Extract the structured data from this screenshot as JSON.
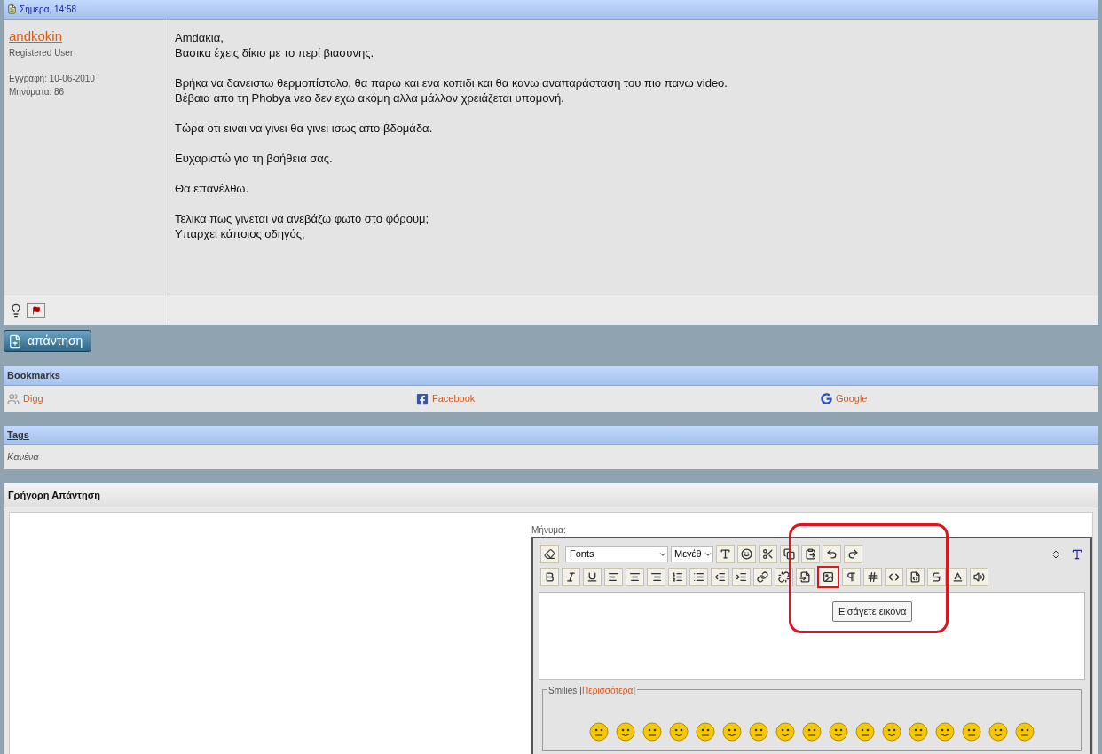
{
  "post": {
    "date": "Σήμερα, 14:58",
    "user": {
      "name": "andkokin",
      "title": "Registered User",
      "joined": "Εγγραφή: 10-06-2010",
      "posts": "Μηνύματα: 86"
    },
    "paragraphs": [
      [
        "Amdακια,",
        "Βασικα έχεις δίκιο με το περί βιασυνης."
      ],
      [
        "Βρήκα να δανειστω θερμοπίστολο, θα παρω και ενα κοπιδι και θα κανω αναπαράσταση του πιο πανω video.",
        "Βέβαια απο τη Phobya νεο δεν εχω ακόμη αλλα μάλλον χρειάζεται υπομονή."
      ],
      [
        "Τώρα οτι ειναι να γινει θα γινει ισως απο βδομάδα."
      ],
      [
        "Ευχαριστώ για τη βοήθεια σας."
      ],
      [
        "Θα επανέλθω."
      ],
      [
        "Τελικα πως γινεται να ανεβάζω φωτο στο φόρουμ;",
        "Υπαρχει κάποιος οδηγός;"
      ]
    ]
  },
  "reply_button": "απάντηση",
  "bookmarks": {
    "title": "Bookmarks",
    "items": [
      {
        "kind": "digg",
        "label": "Digg"
      },
      {
        "kind": "facebook",
        "label": "Facebook"
      },
      {
        "kind": "google",
        "label": "Google"
      }
    ]
  },
  "tags": {
    "title": "Tags",
    "value": "Κανένα"
  },
  "quick_reply": {
    "title": "Γρήγορη Απάντηση",
    "message_label": "Μήνυμα:",
    "font_select": "Fonts",
    "size_select": "Μεγέθ",
    "toolbar_row1": [
      {
        "kind": "color",
        "highlighted": false
      },
      {
        "kind": "smiley",
        "highlighted": false
      },
      {
        "kind": "cut",
        "highlighted": false
      },
      {
        "kind": "copy",
        "highlighted": false
      },
      {
        "kind": "paste",
        "highlighted": false
      },
      {
        "kind": "undo",
        "highlighted": false
      },
      {
        "kind": "redo",
        "highlighted": false
      }
    ],
    "toolbar_row2": [
      {
        "kind": "bold",
        "highlighted": false
      },
      {
        "kind": "italic",
        "highlighted": false
      },
      {
        "kind": "underline",
        "highlighted": false
      },
      {
        "kind": "align-left",
        "highlighted": false
      },
      {
        "kind": "align-center",
        "highlighted": false
      },
      {
        "kind": "align-right",
        "highlighted": false
      },
      {
        "kind": "ordered-list",
        "highlighted": false
      },
      {
        "kind": "list",
        "highlighted": false
      },
      {
        "kind": "outdent",
        "highlighted": false
      },
      {
        "kind": "indent",
        "highlighted": false
      },
      {
        "kind": "link",
        "highlighted": false
      },
      {
        "kind": "unlink",
        "highlighted": false
      },
      {
        "kind": "email",
        "highlighted": false
      },
      {
        "kind": "image",
        "highlighted": true
      },
      {
        "kind": "quote",
        "highlighted": false
      },
      {
        "kind": "hash",
        "highlighted": false
      },
      {
        "kind": "code",
        "highlighted": false
      },
      {
        "kind": "php",
        "highlighted": false
      },
      {
        "kind": "strike",
        "highlighted": false
      },
      {
        "kind": "spoiler",
        "highlighted": false
      },
      {
        "kind": "media",
        "highlighted": false
      }
    ],
    "tooltip": "Εισάγετε εικόνα",
    "smilies_label": "Smilies",
    "smilies_open": "[",
    "smilies_more": "Περισσότερα",
    "smilies_close": "]"
  }
}
